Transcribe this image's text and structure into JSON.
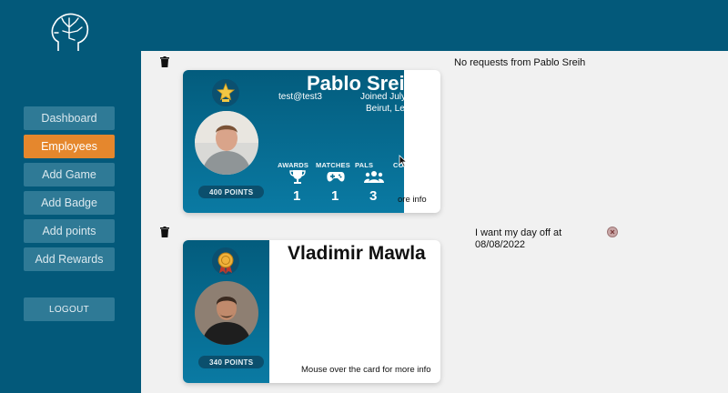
{
  "sidebar": {
    "items": [
      {
        "label": "Dashboard"
      },
      {
        "label": "Employees"
      },
      {
        "label": "Add Game"
      },
      {
        "label": "Add Badge"
      },
      {
        "label": "Add points"
      },
      {
        "label": "Add Rewards"
      }
    ],
    "logout_label": "LOGOUT"
  },
  "employees": [
    {
      "name": "Pablo Sreih",
      "email": "test@test3",
      "joined": "Joined July",
      "location": "Beirut, Le",
      "points": "400 POINTS",
      "stats": [
        {
          "label": "AWARDS",
          "value": "1"
        },
        {
          "label": "MATCHES",
          "value": "1"
        },
        {
          "label": "PALS",
          "value": "3"
        },
        {
          "label": "CO",
          "value": ""
        }
      ],
      "hint": "ore info",
      "request": "No requests from Pablo Sreih"
    },
    {
      "name": "Vladimir Mawla",
      "points": "340 POINTS",
      "hint": "Mouse over the card for more info",
      "request": "I want my day off at 08/08/2022"
    }
  ],
  "colors": {
    "primary": "#03597a",
    "accent": "#e5872d"
  }
}
